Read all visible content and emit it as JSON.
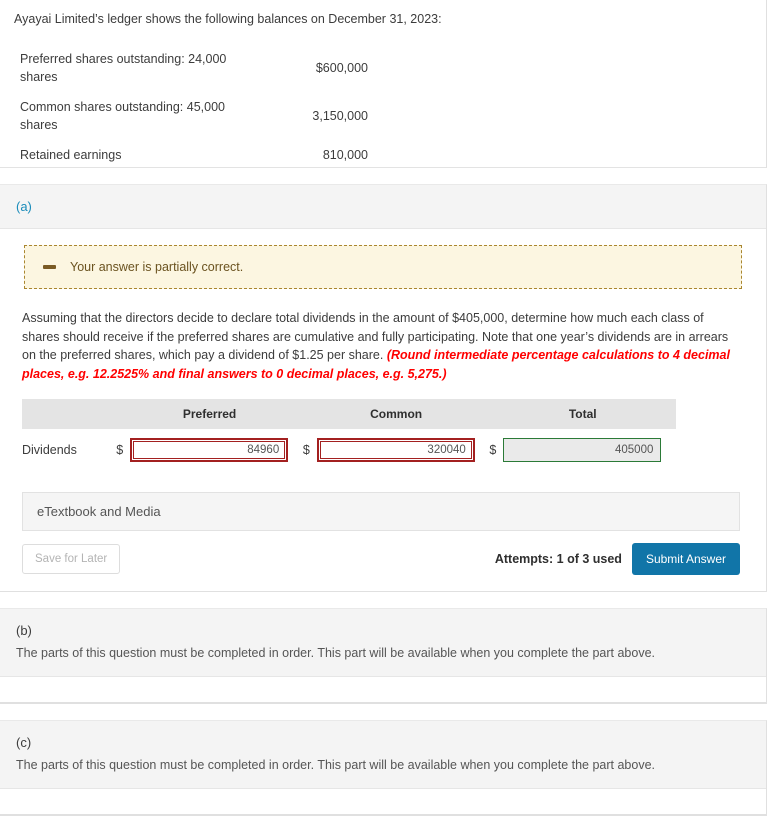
{
  "intro": {
    "lead": "Ayayai Limited’s ledger shows the following balances on December 31, 2023:",
    "rows": [
      {
        "label": "Preferred shares outstanding: 24,000 shares",
        "amount": "$600,000"
      },
      {
        "label": "Common shares outstanding: 45,000 shares",
        "amount": "3,150,000"
      },
      {
        "label": "Retained earnings",
        "amount": "810,000"
      }
    ]
  },
  "part_a": {
    "letter": "(a)",
    "alert": {
      "icon": "minus-icon",
      "text": "Your answer is partially correct."
    },
    "question": {
      "body": "Assuming that the directors decide to declare total dividends in the amount of $405,000, determine how much each class of shares should receive if the preferred shares are cumulative and fully participating. Note that one year’s dividends are in arrears on the preferred shares, which pay a dividend of $1.25 per share. ",
      "emphasis": "(Round intermediate percentage calculations to 4 decimal places, e.g. 12.2525% and final answers to 0 decimal places, e.g. 5,275.)"
    },
    "table": {
      "headers": [
        "",
        "Preferred",
        "Common",
        "Total"
      ],
      "row_label": "Dividends",
      "currency_symbol": "$",
      "cells": [
        {
          "name": "preferred",
          "value": "84960",
          "state": "incorrect"
        },
        {
          "name": "common",
          "value": "320040",
          "state": "incorrect"
        },
        {
          "name": "total",
          "value": "405000",
          "state": "correct-readonly"
        }
      ]
    },
    "etextbook_label": "eTextbook and Media",
    "save_label": "Save for Later",
    "attempts_label": "Attempts: 1 of 3 used",
    "submit_label": "Submit Answer"
  },
  "part_b": {
    "letter": "(b)",
    "locked_text": "The parts of this question must be completed in order. This part will be available when you complete the part above."
  },
  "part_c": {
    "letter": "(c)",
    "locked_text": "The parts of this question must be completed in order. This part will be available when you complete the part above."
  },
  "colors": {
    "accent_blue": "#1175a8",
    "letter_a_teal": "#1a8cba",
    "error_red": "#a32020",
    "emphasis_red": "#ff0000",
    "correct_green": "#2b7a37",
    "alert_bg": "#fcf6e1",
    "alert_border": "#a9862f"
  }
}
